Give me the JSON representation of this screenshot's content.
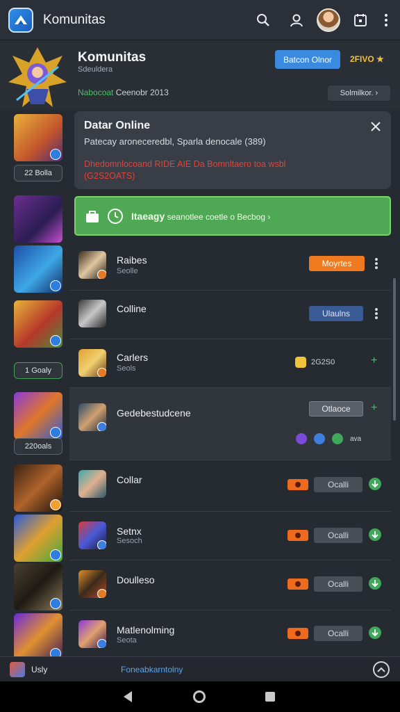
{
  "appbar": {
    "title": "Komunitas"
  },
  "header": {
    "title": "Komunitas",
    "subtitle": "Sdeuldera",
    "status_ok": "Nabocoat",
    "status_rest": "Ceenobr 2013",
    "primary_button": "Batcon Olnor",
    "points": "2FIVO ★",
    "filter_button": "Solmilkor. ›"
  },
  "left_cards": [
    {
      "count": "22 Bolla"
    },
    {
      "count": "1 Goaly"
    },
    {
      "count": "220oals"
    }
  ],
  "notice": {
    "title": "Datar Online",
    "body": "Patecay aroneceredbl, Sparla denocale (389)",
    "warning": "Dhedomnlocoand RIDE AIE Da Bomnltaero toa wsbl (G2S2OATS)"
  },
  "banner": {
    "text_bold": "Itaeagy",
    "text_rest": "seanotlee coetle o Becbog ›"
  },
  "rows": [
    {
      "name": "Raibes",
      "sub": "Seolle",
      "button": "Moyrtes"
    },
    {
      "name": "Colline",
      "sub": "",
      "button": "Ulaulns"
    },
    {
      "name": "Carlers",
      "sub": "Seols",
      "value": "2G2S0"
    },
    {
      "name": "Gedebestudcene",
      "sub": "",
      "button": "Otlaoce",
      "icons_text": "ava"
    },
    {
      "name": "Collar",
      "sub": "",
      "button": "Ocalli"
    },
    {
      "name": "Setnx",
      "sub": "Sesoch",
      "button": "Ocalli"
    },
    {
      "name": "Doulleso",
      "sub": "",
      "button": "Ocalli"
    },
    {
      "name": "Matlenolming",
      "sub": "Seota",
      "button": "Ocalli"
    }
  ],
  "bottombar": {
    "label": "Usly",
    "link": "Foneabkarntolny"
  },
  "colors": {
    "accent_blue": "#3a8be0",
    "accent_orange": "#f07a1f",
    "accent_green": "#4fa954",
    "warning_red": "#e0443b"
  }
}
